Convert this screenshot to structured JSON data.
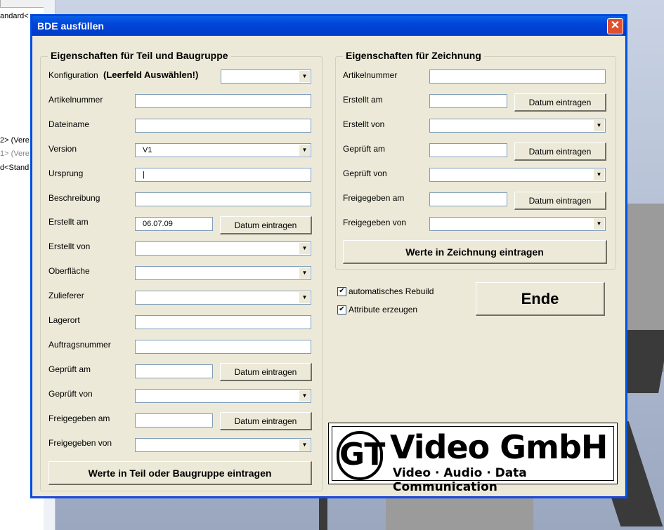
{
  "background": {
    "tree_lines": [
      "andard<",
      "2> (Vere",
      "1> (Vere",
      "d<Stand"
    ]
  },
  "dialog": {
    "title": "BDE ausfüllen",
    "close_glyph": "✕",
    "left_group": {
      "title": "Eigenschaften für Teil und Baugruppe",
      "konfiguration_label": "Konfiguration",
      "konfiguration_hint": "(Leerfeld Auswählen!)",
      "konfiguration_value": "",
      "artikelnummer_label": "Artikelnummer",
      "artikelnummer_value": "",
      "dateiname_label": "Dateiname",
      "dateiname_value": "",
      "version_label": "Version",
      "version_value": "V1",
      "ursprung_label": "Ursprung",
      "ursprung_value": "|",
      "beschreibung_label": "Beschreibung",
      "beschreibung_value": "",
      "erstellt_am_label": "Erstellt am",
      "erstellt_am_value": "06.07.09",
      "erstellt_von_label": "Erstellt von",
      "oberflaeche_label": "Oberfläche",
      "zulieferer_label": "Zulieferer",
      "lagerort_label": "Lagerort",
      "auftragsnummer_label": "Auftragsnummer",
      "geprueft_am_label": "Geprüft am",
      "geprueft_von_label": "Geprüft von",
      "freigegeben_am_label": "Freigegeben am",
      "freigegeben_von_label": "Freigegeben von",
      "datum_button": "Datum eintragen",
      "submit_button": "Werte in Teil oder Baugruppe eintragen"
    },
    "right_group": {
      "title": "Eigenschaften für Zeichnung",
      "artikelnummer_label": "Artikelnummer",
      "erstellt_am_label": "Erstellt am",
      "erstellt_von_label": "Erstellt von",
      "geprueft_am_label": "Geprüft am",
      "geprueft_von_label": "Geprüft von",
      "freigegeben_am_label": "Freigegeben am",
      "freigegeben_von_label": "Freigegeben von",
      "datum_button": "Datum eintragen",
      "submit_button": "Werte in Zeichnung eintragen"
    },
    "options": {
      "rebuild_label": "automatisches Rebuild",
      "rebuild_checked": true,
      "attribute_label": "Attribute erzeugen",
      "attribute_checked": true,
      "check_glyph": "✔"
    },
    "ende_button": "Ende",
    "logo": {
      "mark": "GT",
      "name": "Video GmbH",
      "tagline": "Video · Audio · Data Communication"
    },
    "dropdown_arrow": "▼"
  }
}
